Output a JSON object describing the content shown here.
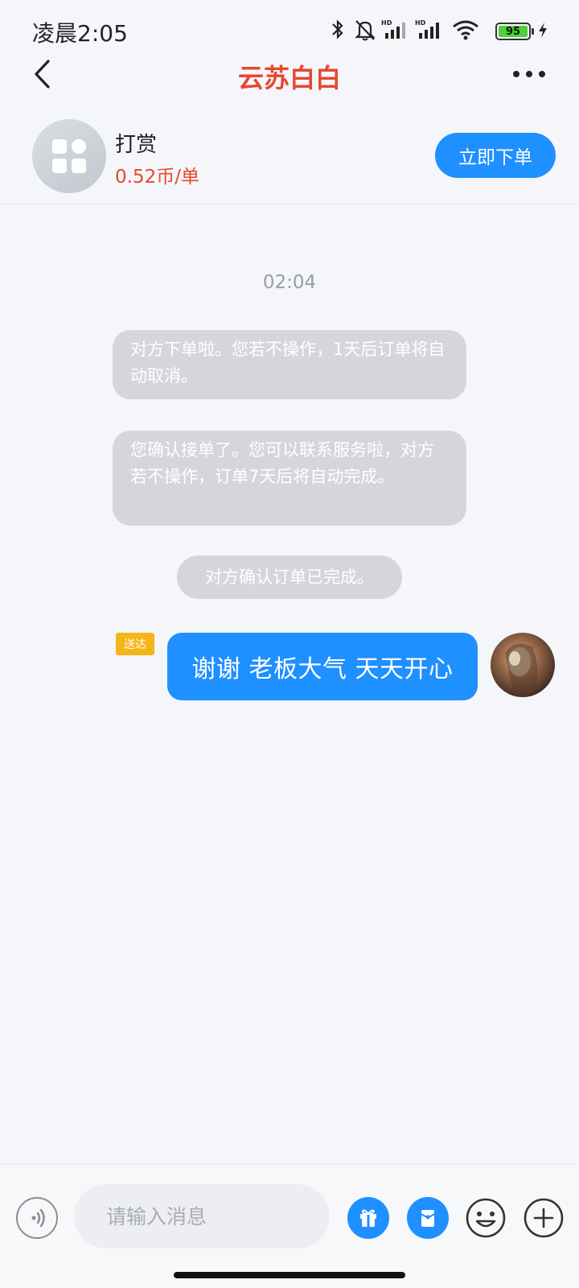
{
  "status_bar": {
    "time": "凌晨2:05",
    "battery": "95",
    "icons": [
      "bluetooth-icon",
      "mute-bell-icon",
      "hd-signal-icon",
      "hd-signal-icon",
      "wifi-icon",
      "battery-icon",
      "charging-icon"
    ]
  },
  "header": {
    "title": "云苏白白",
    "back_icon": "back-chevron-icon",
    "more_icon": "more-dots-icon"
  },
  "service": {
    "name": "打赏",
    "price": "0.52币/单",
    "order_button": "立即下单"
  },
  "chat": {
    "timestamp": "02:04",
    "system_messages": [
      "对方下单啦。您若不操作，1天后订单将自动取消。",
      "您确认接单了。您可以联系服务啦，对方若不操作，订单7天后将自动完成。",
      "对方确认订单已完成。"
    ],
    "outgoing": {
      "status": "送达",
      "text": "谢谢 老板大气 天天开心"
    }
  },
  "input_bar": {
    "placeholder": "请输入消息",
    "icons": [
      "voice-icon",
      "gift-icon",
      "red-packet-icon",
      "emoji-icon",
      "plus-icon"
    ]
  },
  "colors": {
    "accent": "#1e90ff",
    "title_red": "#e8472f",
    "system_bubble": "#d4d6da",
    "badge": "#f5b417"
  }
}
